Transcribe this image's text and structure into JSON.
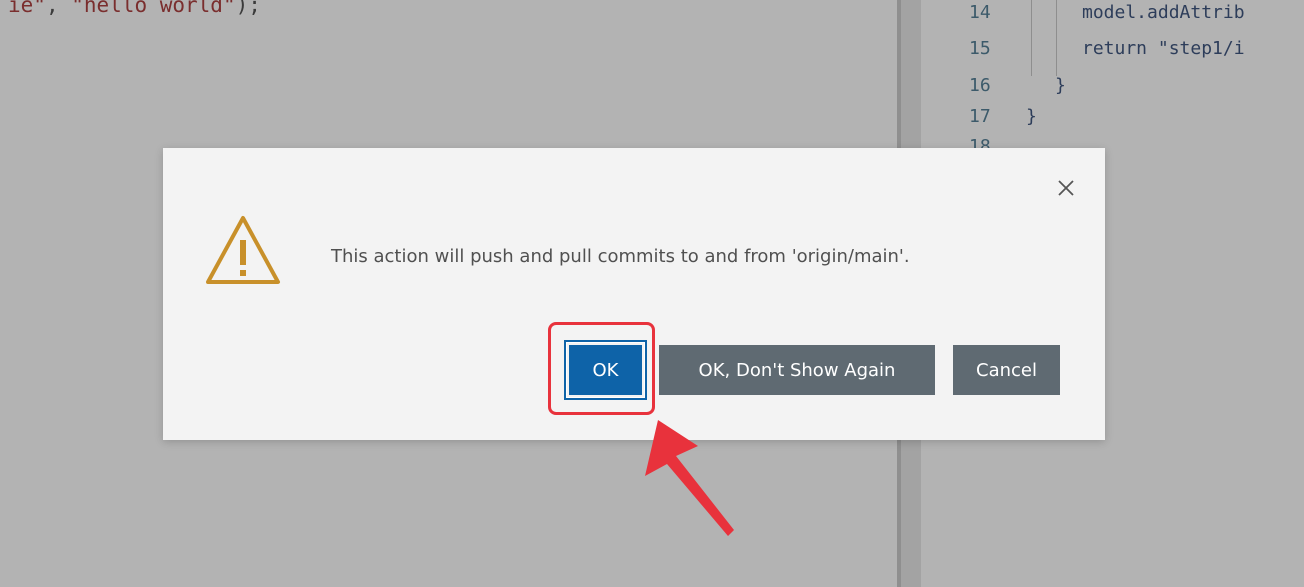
{
  "editor_left": {
    "code_fragment_str1": "ie\"",
    "code_fragment_punc1": ", ",
    "code_fragment_str2": "\"hello world\"",
    "code_fragment_punc2": ");"
  },
  "editor_right": {
    "lines": [
      {
        "number": "14",
        "code": "model.addAttrib"
      },
      {
        "number": "15",
        "code": "return \"step1/i"
      },
      {
        "number": "16",
        "code": "}"
      },
      {
        "number": "17",
        "code": "}"
      },
      {
        "number": "18",
        "code": ""
      }
    ]
  },
  "dialog": {
    "message": "This action will push and pull commits to and from 'origin/main'.",
    "close_icon": "close-icon",
    "warning_icon": "warning-icon",
    "buttons": {
      "ok": "OK",
      "dont_show_again": "OK, Don't Show Again",
      "cancel": "Cancel"
    }
  },
  "colors": {
    "primary_button": "#0e63a8",
    "secondary_button": "#5f6a72",
    "warning_icon": "#c8902a",
    "annotation": "#e8323c"
  }
}
